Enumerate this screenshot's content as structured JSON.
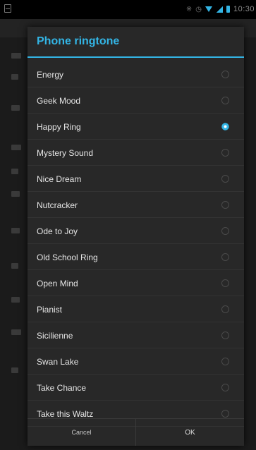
{
  "status_bar": {
    "time": "10:30",
    "icons": [
      "sim-icon",
      "bluetooth-icon",
      "alarm-icon",
      "wifi-icon",
      "signal-icon",
      "battery-icon"
    ],
    "accent_color": "#33b5e5"
  },
  "dialog": {
    "title": "Phone ringtone",
    "accent_color": "#33b5e5",
    "items": [
      {
        "label": "Energy",
        "selected": false
      },
      {
        "label": "Geek Mood",
        "selected": false
      },
      {
        "label": "Happy Ring",
        "selected": true
      },
      {
        "label": "Mystery Sound",
        "selected": false
      },
      {
        "label": "Nice Dream",
        "selected": false
      },
      {
        "label": "Nutcracker",
        "selected": false
      },
      {
        "label": "Ode to Joy",
        "selected": false
      },
      {
        "label": "Old School Ring",
        "selected": false
      },
      {
        "label": "Open Mind",
        "selected": false
      },
      {
        "label": "Pianist",
        "selected": false
      },
      {
        "label": "Sicilienne",
        "selected": false
      },
      {
        "label": "Swan Lake",
        "selected": false
      },
      {
        "label": "Take Chance",
        "selected": false
      },
      {
        "label": "Take this Waltz",
        "selected": false
      }
    ],
    "buttons": {
      "cancel_label": "Cancel",
      "ok_label": "OK"
    }
  }
}
